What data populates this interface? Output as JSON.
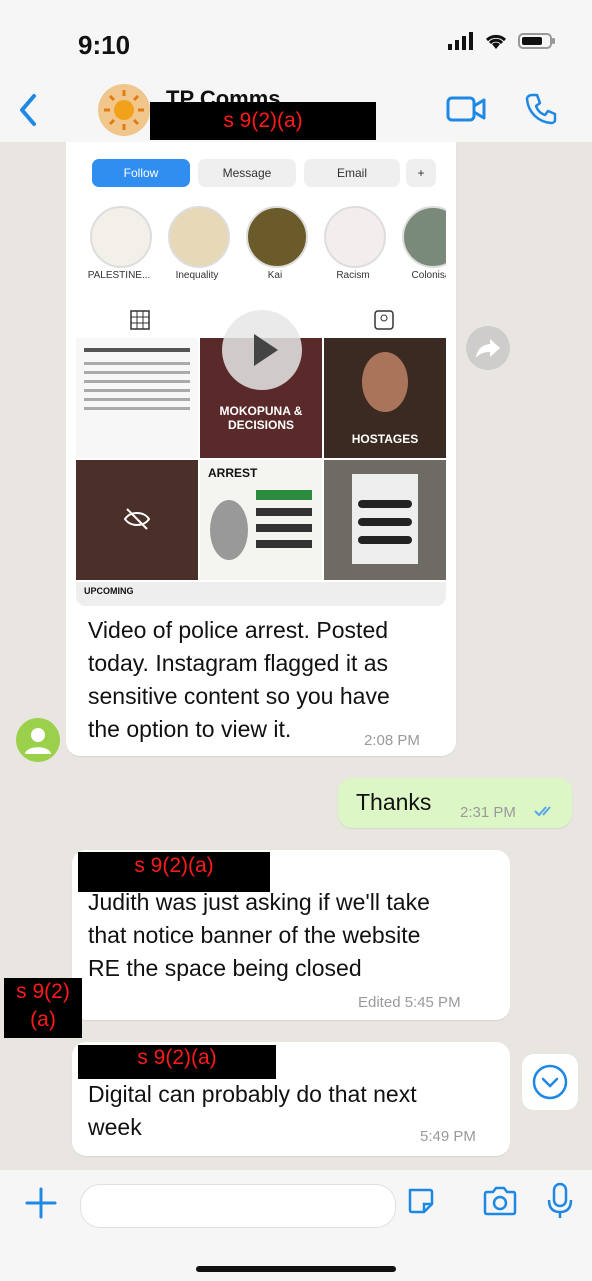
{
  "status_bar": {
    "time": "9:10"
  },
  "header": {
    "title": "TP Comms",
    "redaction": "s 9(2)(a)",
    "icons": [
      "back-chevron-icon",
      "video-call-icon",
      "phone-icon"
    ]
  },
  "shared_screenshot": {
    "buttons": [
      "Follow",
      "Message",
      "Email",
      "+"
    ],
    "highlights": [
      "PALESTINE...",
      "Inequality",
      "Kai",
      "Racism",
      "Colonisa"
    ],
    "tiles": [
      {
        "caption": ""
      },
      {
        "caption": "MOKOPUNA & DECISIONS"
      },
      {
        "caption": "HOSTAGES"
      },
      {
        "caption": ""
      },
      {
        "caption": "ARREST"
      },
      {
        "caption": ""
      },
      {
        "caption": "UPCOMING"
      }
    ]
  },
  "messages": [
    {
      "direction": "in",
      "text_lines": [
        "Video of police arrest. Posted",
        "today. Instagram flagged it as",
        "sensitive content so you have",
        "the option to view it."
      ],
      "time": "2:08 PM"
    },
    {
      "direction": "out",
      "text": "Thanks",
      "time": "2:31 PM",
      "status": "read"
    },
    {
      "direction": "in",
      "sender_redaction": "s 9(2)(a)",
      "text_lines": [
        "Judith was just asking if we'll take",
        "that notice banner of the website",
        "RE the space being closed"
      ],
      "time": "Edited 5:45 PM"
    },
    {
      "direction": "in",
      "sender_redaction": "s 9(2)(a)",
      "text_lines": [
        "Digital can probably do that next",
        "week"
      ],
      "time": "5:49 PM"
    }
  ],
  "side_redaction": {
    "line1": "s 9(2)",
    "line2": "(a)"
  },
  "input_bar": {
    "placeholder": ""
  },
  "colors": {
    "accent": "#1e88e5",
    "incoming": "#ffffff",
    "outgoing": "#dcf6c6",
    "redaction_text": "#ff1a1a"
  }
}
